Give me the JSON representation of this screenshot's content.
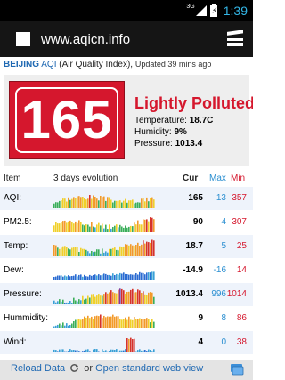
{
  "status_bar": {
    "network": "3G",
    "time": "1:39"
  },
  "browser": {
    "url": "www.aqicn.info"
  },
  "header": {
    "city": "BEIJING",
    "aqi_label": "AQI",
    "aqi_full": "(Air Quality Index),",
    "updated": "Updated 39 mins ago"
  },
  "summary": {
    "aqi": "165",
    "status": "Lightly Polluted",
    "temperature_label": "Temperature:",
    "temperature": "18.7C",
    "humidity_label": "Humidity:",
    "humidity": "9%",
    "pressure_label": "Pressure:",
    "pressure": "1013.4",
    "color": "#d5172d"
  },
  "table": {
    "headers": {
      "item": "Item",
      "evolution": "3 days evolution",
      "cur": "Cur",
      "max": "Max",
      "min": "Min"
    },
    "rows": [
      {
        "label": "AQI:",
        "cur": "165",
        "max": "13",
        "min": "357"
      },
      {
        "label": "PM2.5:",
        "cur": "90",
        "max": "4",
        "min": "307"
      },
      {
        "label": "Temp:",
        "cur": "18.7",
        "max": "5",
        "min": "25"
      },
      {
        "label": "Dew:",
        "cur": "-14.9",
        "max": "-16",
        "min": "14"
      },
      {
        "label": "Pressure:",
        "cur": "1013.4",
        "max": "996",
        "min": "1014"
      },
      {
        "label": "Hummidity:",
        "cur": "9",
        "max": "8",
        "min": "86"
      },
      {
        "label": "Wind:",
        "cur": "4",
        "max": "0",
        "min": "38"
      }
    ]
  },
  "footer": {
    "reload": "Reload Data",
    "or": "or",
    "open_web": "Open standard web view"
  }
}
